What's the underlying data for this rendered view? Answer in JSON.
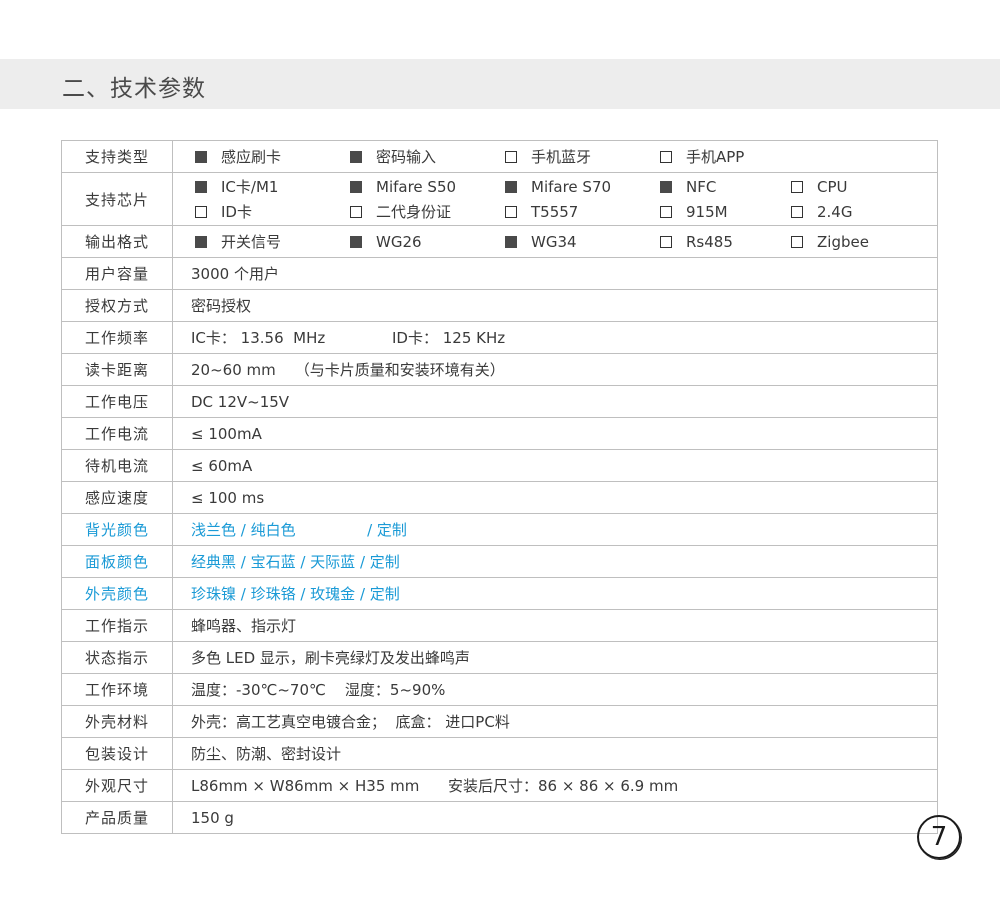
{
  "title": "二、技术参数",
  "page_number": "7",
  "colors": {
    "highlight": "#1a9ad6",
    "header_bg": "#ededed",
    "border": "#bfbfbf"
  },
  "rows": {
    "support_type": {
      "label": "支持类型",
      "options": [
        {
          "text": "感应刷卡",
          "checked": true
        },
        {
          "text": "密码输入",
          "checked": true
        },
        {
          "text": "手机蓝牙",
          "checked": false
        },
        {
          "text": "手机APP",
          "checked": false
        }
      ]
    },
    "chip": {
      "label": "支持芯片",
      "options": [
        {
          "text": "IC卡/M1",
          "checked": true
        },
        {
          "text": "Mifare S50",
          "checked": true
        },
        {
          "text": "Mifare S70",
          "checked": true
        },
        {
          "text": "NFC",
          "checked": true
        },
        {
          "text": "CPU",
          "checked": false
        },
        {
          "text": "ID卡",
          "checked": false
        },
        {
          "text": "二代身份证",
          "checked": false
        },
        {
          "text": "T5557",
          "checked": false
        },
        {
          "text": "915M",
          "checked": false
        },
        {
          "text": "2.4G",
          "checked": false
        }
      ]
    },
    "output": {
      "label": "输出格式",
      "options": [
        {
          "text": "开关信号",
          "checked": true
        },
        {
          "text": "WG26",
          "checked": true
        },
        {
          "text": "WG34",
          "checked": true
        },
        {
          "text": "Rs485",
          "checked": false
        },
        {
          "text": "Zigbee",
          "checked": false
        }
      ]
    },
    "capacity": {
      "label": "用户容量",
      "value": "3000 个用户"
    },
    "auth": {
      "label": "授权方式",
      "value": "密码授权"
    },
    "frequency": {
      "label": "工作频率",
      "value": "IC卡： 13.56  MHz              ID卡： 125 KHz"
    },
    "distance": {
      "label": "读卡距离",
      "value": "20~60 mm    （与卡片质量和安装环境有关）"
    },
    "voltage": {
      "label": "工作电压",
      "value": "DC 12V~15V"
    },
    "current": {
      "label": "工作电流",
      "value": "≤ 100mA"
    },
    "standby": {
      "label": "待机电流",
      "value": "≤ 60mA"
    },
    "speed": {
      "label": "感应速度",
      "value": "≤ 100 ms"
    },
    "backlight": {
      "label": "背光颜色",
      "value": "浅兰色 / 纯白色               / 定制"
    },
    "panel": {
      "label": "面板颜色",
      "value": "经典黑 / 宝石蓝 / 天际蓝 / 定制"
    },
    "shell_color": {
      "label": "外壳颜色",
      "value": "珍珠镍 / 珍珠铬 / 玫瑰金 / 定制"
    },
    "indicator": {
      "label": "工作指示",
      "value": "蜂鸣器、指示灯"
    },
    "status": {
      "label": "状态指示",
      "value": "多色 LED 显示，刷卡亮绿灯及发出蜂鸣声"
    },
    "environment": {
      "label": "工作环境",
      "value": "温度：-30℃~70℃    湿度：5~90%"
    },
    "material": {
      "label": "外壳材料",
      "value": "外壳：高工艺真空电镀合金；  底盒： 进口PC料"
    },
    "packaging": {
      "label": "包装设计",
      "value": "防尘、防潮、密封设计"
    },
    "dimensions": {
      "label": "外观尺寸",
      "value": "L86mm × W86mm × H35 mm      安装后尺寸：86 × 86 × 6.9 mm"
    },
    "weight": {
      "label": "产品质量",
      "value": "150 g"
    }
  }
}
